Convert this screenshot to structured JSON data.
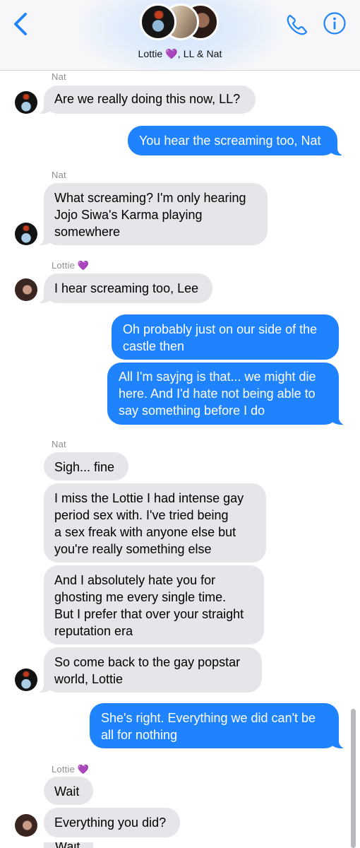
{
  "header": {
    "group_name": "Lottie 💜, LL & Nat",
    "back_icon": "chevron-left-icon",
    "call_icon": "phone-icon",
    "info_icon": "info-icon",
    "accent_color": "#1f83fe"
  },
  "messages": [
    {
      "sender": "Nat",
      "text": "Are we really doing this now, LL?"
    },
    {
      "text": "You hear the screaming too, Nat"
    },
    {
      "sender": "Nat",
      "text": "What screaming? I'm only hearing\nJojo Siwa's Karma playing\nsomewhere"
    },
    {
      "sender": "Lottie 💜",
      "text": "I hear screaming too, Lee"
    },
    {
      "text": "Oh probably just on our side of the\ncastle then"
    },
    {
      "text": "All I'm sayjng is that... we might die\nhere. And I'd hate not being able to\nsay something before I do"
    },
    {
      "sender": "Nat",
      "text": "Sigh... fine"
    },
    {
      "text": "I miss the Lottie I had intense gay\nperiod sex with. I've tried being\na sex freak with anyone else but\nyou're really something else"
    },
    {
      "text": "And I absolutely hate you for\nghosting me every single time.\nBut I prefer that over your straight\nreputation era"
    },
    {
      "text": "So come back to the gay popstar\nworld, Lottie"
    },
    {
      "text": "She's right. Everything we did can't be\nall for nothing"
    },
    {
      "sender": "Lottie 💜",
      "text": "Wait"
    },
    {
      "text": "Everything you did?"
    },
    {
      "text": "Wait"
    }
  ],
  "colors": {
    "outgoing_bubble": "#1f83fe",
    "incoming_bubble": "#e5e5ea"
  }
}
